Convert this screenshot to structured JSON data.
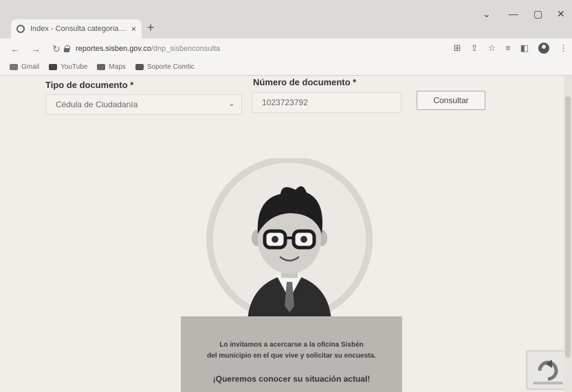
{
  "browser": {
    "tab_title": "Index - Consulta categoria Sisben",
    "tab_close": "×",
    "new_tab": "+",
    "url_host": "reportes.sisben.gov.co",
    "url_path": "/dnp_sisbenconsulta",
    "bookmarks": [
      {
        "label": "Gmail",
        "icon": "gmail-icon",
        "color": "#777"
      },
      {
        "label": "YouTube",
        "icon": "youtube-icon",
        "color": "#444"
      },
      {
        "label": "Maps",
        "icon": "maps-icon",
        "color": "#666"
      },
      {
        "label": "Soporte Comtic",
        "icon": "folder-icon",
        "color": "#555"
      }
    ]
  },
  "form": {
    "tipo_label": "Tipo de documento *",
    "tipo_value": "Cédula de Ciudadanía",
    "numero_label": "Número de documento *",
    "numero_value": "1023723792",
    "consultar_label": "Consultar"
  },
  "message": {
    "line1": "Lo invitamos a acercarse a la oficina Sisbén",
    "line2": "del municipio en el que vive y solicitar su encuesta.",
    "cta": "¡Queremos conocer su situación actual!"
  },
  "colors": {
    "page_bg": "#f1eee9",
    "message_bg": "#b9b6b1",
    "circle": "#d9d6d1"
  }
}
